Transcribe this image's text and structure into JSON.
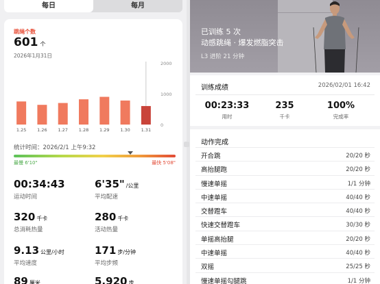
{
  "tabs": [
    {
      "label": "每日",
      "active": true
    },
    {
      "label": "每月",
      "active": false
    }
  ],
  "summary": {
    "title": "跳绳个数",
    "count": "601",
    "count_unit": "个",
    "date": "2026年1月31日",
    "accent_color": "#e8513a"
  },
  "chart_data": {
    "type": "bar",
    "categories": [
      "1.25",
      "1.26",
      "1.27",
      "1.28",
      "1.29",
      "1.30",
      "1.31"
    ],
    "values": [
      750,
      640,
      700,
      820,
      900,
      780,
      601
    ],
    "ylim": [
      0,
      2000
    ],
    "yticks": [
      "2000",
      "1000",
      "0"
    ],
    "highlight_index": 6,
    "colors": {
      "normal": "#f07a5e",
      "highlight": "#c9443a"
    }
  },
  "stat_time": "统计时间：2026/2/1 上午9:32",
  "gauge": {
    "slow_label": "最慢 6'10\"",
    "fast_label": "最快 5'08\"",
    "marker_fraction": 0.72
  },
  "metrics": [
    {
      "value": "00:34:43",
      "unit": "",
      "label": "运动时间"
    },
    {
      "value": "6'35\"",
      "unit": "/公里",
      "label": "平均配速"
    },
    {
      "value": "320",
      "unit": "千卡",
      "label": "总消耗热量"
    },
    {
      "value": "280",
      "unit": "千卡",
      "label": "活动热量"
    },
    {
      "value": "9.13",
      "unit": "公里/小时",
      "label": "平均速度"
    },
    {
      "value": "171",
      "unit": "步/分钟",
      "label": "平均步频"
    },
    {
      "value": "89",
      "unit": "厘米",
      "label": ""
    },
    {
      "value": "5,920",
      "unit": "步",
      "label": ""
    }
  ],
  "hero": {
    "line1": "已训练 5 次",
    "line2": "动感跳绳 · 爆发燃脂突击",
    "line3": "L3 进阶  21 分钟"
  },
  "result": {
    "title": "训练成绩",
    "datetime": "2026/02/01 16:42",
    "items": [
      {
        "value": "00:23:33",
        "label": "用时"
      },
      {
        "value": "235",
        "label": "千卡"
      },
      {
        "value": "100%",
        "label": "完成率"
      }
    ]
  },
  "actions": {
    "title": "动作完成",
    "rows": [
      {
        "name": "开合跳",
        "count": "20/20 秒"
      },
      {
        "name": "高抬腿跑",
        "count": "20/20 秒"
      },
      {
        "name": "慢速单摇",
        "count": "1/1 分钟"
      },
      {
        "name": "中速单摇",
        "count": "40/40 秒"
      },
      {
        "name": "交替蹬车",
        "count": "40/40 秒"
      },
      {
        "name": "快速交替蹬车",
        "count": "30/30 秒"
      },
      {
        "name": "单摇高抬腿",
        "count": "20/20 秒"
      },
      {
        "name": "中速单摇",
        "count": "40/40 秒"
      },
      {
        "name": "双摇",
        "count": "25/25 秒"
      },
      {
        "name": "慢速单摇勾腿跳",
        "count": "1/1 分钟"
      }
    ]
  }
}
